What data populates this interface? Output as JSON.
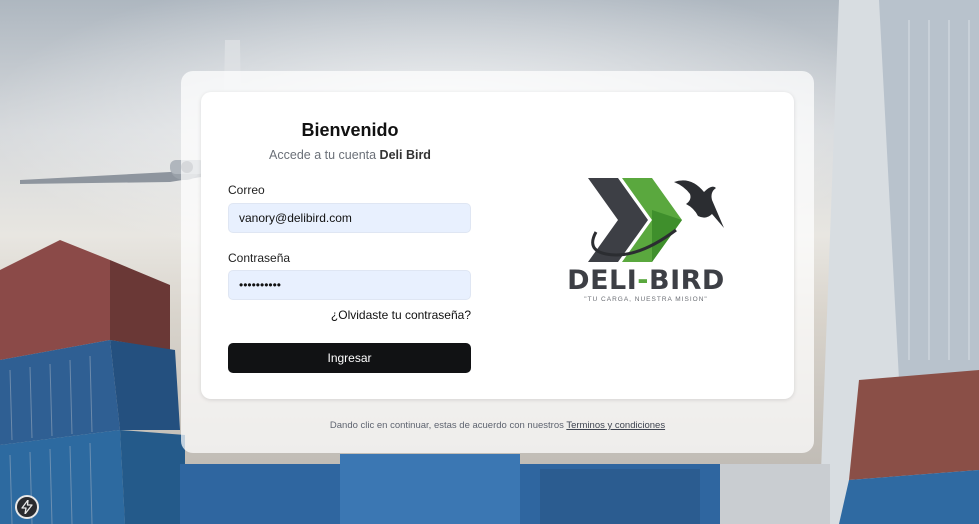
{
  "login": {
    "title": "Bienvenido",
    "subtitle_prefix": "Accede a tu cuenta ",
    "subtitle_brand": "Deli Bird",
    "email_label": "Correo",
    "email_value": "vanory@delibird.com",
    "password_label": "Contraseña",
    "password_value": "vanorypass",
    "forgot_link": "¿Olvidaste tu contraseña?",
    "submit_label": "Ingresar"
  },
  "brand": {
    "name_left": "DELI",
    "name_dash": "-",
    "name_right": "BIRD",
    "tagline": "\"TU CARGA, NUESTRA MISION\"",
    "colors": {
      "green": "#5aa83e",
      "gray": "#3d3f45",
      "dark": "#2b2d31"
    }
  },
  "footer": {
    "terms_prefix": "Dando clic en continuar, estas de acuerdo con nuestros ",
    "terms_link": "Terminos y condiciones"
  },
  "badge": {
    "icon": "lightning-icon"
  }
}
